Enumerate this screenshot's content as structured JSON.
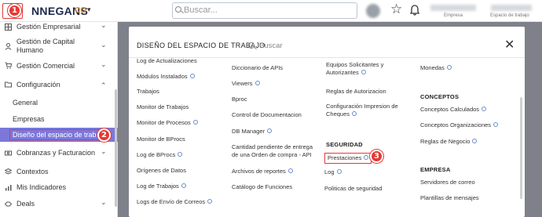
{
  "topbar": {
    "brand": "NNEGANS",
    "brand_suffix": "CO",
    "brand_caret": "▾",
    "search_placeholder": "Buscar...",
    "star_glyph": "☆",
    "company_label": "Empresa",
    "workspace_label": "Espacio de trabajo",
    "step_1": "1"
  },
  "sidebar": {
    "items": [
      {
        "label": "Gestión Empresarial",
        "icon": "grid-icon",
        "chevron": "⌄"
      },
      {
        "label": "Gestión de Capital Humano",
        "icon": "people-icon",
        "chevron": "⌄"
      },
      {
        "label": "Gestión Comercial",
        "icon": "cart-icon",
        "chevron": "⌄"
      },
      {
        "label": "Configuración",
        "icon": "folder-icon",
        "chevron": "⌃"
      }
    ],
    "sub_items": [
      "General",
      "Empresas"
    ],
    "active_item": "Diseño del espacio de trabajo",
    "step_2": "2",
    "bottom_items": [
      {
        "label": "Cobranzas y Facturacion",
        "icon": "money-icon",
        "chevron": "⌄"
      },
      {
        "label": "Contextos",
        "icon": "context-icon"
      },
      {
        "label": "Mis Indicadores",
        "icon": "chart-icon"
      },
      {
        "label": "Deals",
        "icon": "deals-icon",
        "chevron": "⌄"
      }
    ]
  },
  "panel": {
    "title": "DISEÑO DEL ESPACIO DE TRABAJO",
    "search_placeholder": "Buscar",
    "close_glyph": "✕",
    "col1": [
      {
        "label": "Log de Actualizaciones",
        "info": false
      },
      {
        "label": "Módulos Instalados",
        "info": true
      },
      {
        "label": "Trabajos",
        "info": false
      },
      {
        "label": "Monitor de Trabajos",
        "info": false
      },
      {
        "label": "Monitor de Procesos",
        "info": true
      },
      {
        "label": "Monitor de BProcs",
        "info": false
      },
      {
        "label": "Log de BProcs",
        "info": true
      },
      {
        "label": "Orígenes de Datos",
        "info": false
      },
      {
        "label": "Log de Trabajos",
        "info": true
      },
      {
        "label": "Logs de Envío de Correos",
        "info": true
      }
    ],
    "col2": [
      {
        "label": "Diccionario de APIs",
        "info": false
      },
      {
        "label": "Viewers",
        "info": true
      },
      {
        "label": "Bproc",
        "info": false
      },
      {
        "label": "Control de Documentacion",
        "info": false
      },
      {
        "label": "DB Manager",
        "info": true
      },
      {
        "label": "Cantidad pendiente de entrega de una Orden de compra - API",
        "info": false
      },
      {
        "label": "Archivos de reportes",
        "info": true
      },
      {
        "label": "Catálogo de Funciones",
        "info": false
      }
    ],
    "col3": [
      {
        "label": "Equipos Solicitantes y Autorizantes",
        "info": true
      },
      {
        "label": "Reglas de Autorizacion",
        "info": false
      },
      {
        "label": "Configuración Impresion de Cheques",
        "info": true
      }
    ],
    "col3_section": "SEGURIDAD",
    "col3_security": [
      {
        "label": "Prestaciones",
        "info": true
      },
      {
        "label": "Log",
        "info": true
      },
      {
        "label": "Politicas de seguridad",
        "info": false
      }
    ],
    "step_3": "3",
    "col4_top": [
      {
        "label": "Monedas",
        "info": true
      }
    ],
    "col4_section1": "CONCEPTOS",
    "col4_conceptos": [
      {
        "label": "Conceptos Calculados",
        "info": true
      },
      {
        "label": "Conceptos Organizaciones",
        "info": true
      },
      {
        "label": "Reglas de Negocio",
        "info": true
      }
    ],
    "col4_section2": "EMPRESA",
    "col4_empresa": [
      {
        "label": "Servidores de correo",
        "info": false
      },
      {
        "label": "Plantillas de mensajes",
        "info": false
      }
    ]
  }
}
